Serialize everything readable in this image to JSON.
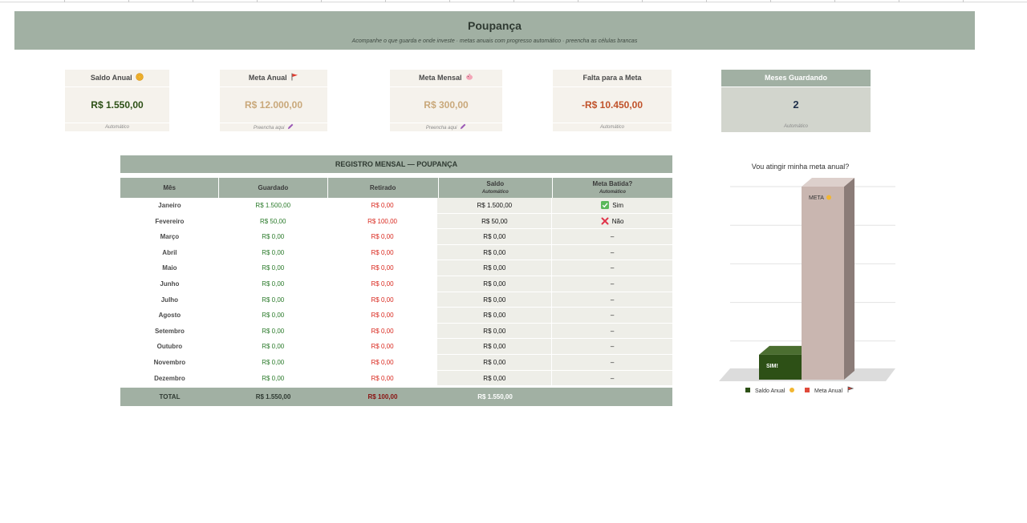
{
  "header": {
    "title": "Poupança",
    "subtitle": "Acompanhe o que guarda e onde investe · metas anuais com progresso automático · preencha as células brancas"
  },
  "cards": {
    "saldo_anual": {
      "label": "Saldo Anual",
      "value": "R$ 1.550,00",
      "note": "Automático"
    },
    "meta_anual": {
      "label": "Meta Anual",
      "value": "R$ 12.000,00",
      "note": "Preencha aqui"
    },
    "meta_mensal": {
      "label": "Meta Mensal",
      "value": "R$ 300,00",
      "note": "Preencha aqui"
    },
    "falta_meta": {
      "label": "Falta para a Meta",
      "value": "-R$ 10.450,00",
      "note": "Automático"
    },
    "meses_guardando": {
      "label": "Meses Guardando",
      "value": "2",
      "note": "Automático"
    }
  },
  "table": {
    "title": "REGISTRO MENSAL — POUPANÇA",
    "headers": {
      "mes": "Mês",
      "guardado": "Guardado",
      "retirado": "Retirado",
      "saldo": "Saldo",
      "saldo_note": "Automático",
      "meta": "Meta Batida?",
      "meta_note": "Automático"
    },
    "rows": [
      {
        "mes": "Janeiro",
        "guardado": "R$ 1.500,00",
        "retirado": "R$ 0,00",
        "saldo": "R$ 1.500,00",
        "meta": "Sim",
        "meta_icon": "check-icon"
      },
      {
        "mes": "Fevereiro",
        "guardado": "R$ 50,00",
        "retirado": "R$ 100,00",
        "saldo": "R$ 50,00",
        "meta": "Não",
        "meta_icon": "cross-icon"
      },
      {
        "mes": "Março",
        "guardado": "R$ 0,00",
        "retirado": "R$ 0,00",
        "saldo": "R$ 0,00",
        "meta": "–"
      },
      {
        "mes": "Abril",
        "guardado": "R$ 0,00",
        "retirado": "R$ 0,00",
        "saldo": "R$ 0,00",
        "meta": "–"
      },
      {
        "mes": "Maio",
        "guardado": "R$ 0,00",
        "retirado": "R$ 0,00",
        "saldo": "R$ 0,00",
        "meta": "–"
      },
      {
        "mes": "Junho",
        "guardado": "R$ 0,00",
        "retirado": "R$ 0,00",
        "saldo": "R$ 0,00",
        "meta": "–"
      },
      {
        "mes": "Julho",
        "guardado": "R$ 0,00",
        "retirado": "R$ 0,00",
        "saldo": "R$ 0,00",
        "meta": "–"
      },
      {
        "mes": "Agosto",
        "guardado": "R$ 0,00",
        "retirado": "R$ 0,00",
        "saldo": "R$ 0,00",
        "meta": "–"
      },
      {
        "mes": "Setembro",
        "guardado": "R$ 0,00",
        "retirado": "R$ 0,00",
        "saldo": "R$ 0,00",
        "meta": "–"
      },
      {
        "mes": "Outubro",
        "guardado": "R$ 0,00",
        "retirado": "R$ 0,00",
        "saldo": "R$ 0,00",
        "meta": "–"
      },
      {
        "mes": "Novembro",
        "guardado": "R$ 0,00",
        "retirado": "R$ 0,00",
        "saldo": "R$ 0,00",
        "meta": "–"
      },
      {
        "mes": "Dezembro",
        "guardado": "R$ 0,00",
        "retirado": "R$ 0,00",
        "saldo": "R$ 0,00",
        "meta": "–"
      }
    ],
    "total": {
      "label": "TOTAL",
      "guardado": "R$ 1.550,00",
      "retirado": "R$ 100,00",
      "saldo": "R$ 1.550,00"
    }
  },
  "colors": {
    "banner": "#a1b0a3",
    "card_bg": "#f5f2ec",
    "saldo_value": "#2d5016",
    "meta_value": "#c9a87a",
    "falta_value": "#c0522a",
    "meses_value": "#1f2f4a",
    "positive": "#2a7a2a",
    "negative": "#d9281e"
  },
  "chart_data": {
    "type": "bar",
    "title": "Vou atingir minha meta anual?",
    "categories": [
      "Saldo Anual",
      "Meta Anual"
    ],
    "values": [
      1550,
      12000
    ],
    "data_labels": [
      "SIM!",
      "META"
    ],
    "legend": [
      "Saldo Anual",
      "Meta Anual"
    ],
    "legend_position": "bottom",
    "colors": [
      "#2d5016",
      "#c9b6b0"
    ],
    "legend_marker_colors": [
      "#2d5016",
      "#e04a3a"
    ],
    "ylim": [
      0,
      12000
    ],
    "grid": true,
    "style": "3d"
  }
}
